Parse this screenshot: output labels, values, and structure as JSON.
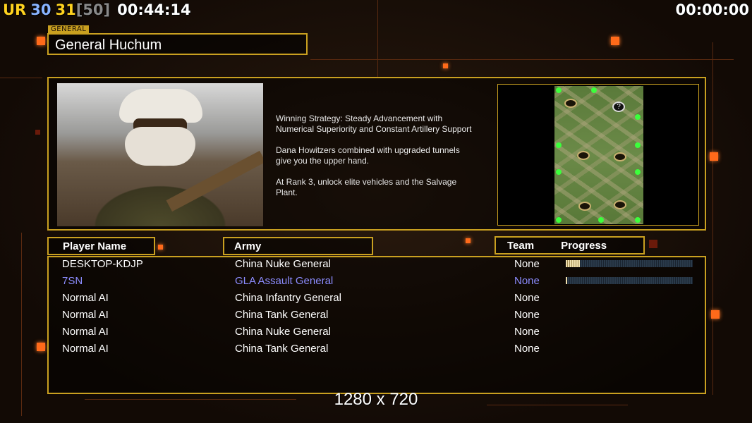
{
  "hud": {
    "ur": "UR",
    "n1": "30",
    "n2": "31",
    "bracket": "[50]",
    "clock_left": "00:44:14",
    "clock_right": "00:00:00"
  },
  "general": {
    "label": "GENERAL",
    "name": "General Huchum"
  },
  "strategy": {
    "p1": "Winning Strategy: Steady Advancement with\n Numerical Superiority and Constant Artillery Support",
    "p2": "Dana Howitzers combined with upgraded tunnels\n give you the upper hand.",
    "p3": "At Rank 3, unlock elite vehicles and the Salvage\n Plant."
  },
  "minimap": {
    "question": "?"
  },
  "headers": {
    "player": "Player Name",
    "army": "Army",
    "team": "Team",
    "progress": "Progress"
  },
  "players": [
    {
      "name": "DESKTOP-KDJP",
      "army": "China Nuke General",
      "team": "None",
      "progress": 0.11
    },
    {
      "name": "7SN",
      "army": "GLA Assault General",
      "team": "None",
      "progress": 0.01
    },
    {
      "name": "Normal AI",
      "army": "China Infantry General",
      "team": "None"
    },
    {
      "name": "Normal AI",
      "army": "China Tank General",
      "team": "None"
    },
    {
      "name": "Normal AI",
      "army": "China Nuke General",
      "team": "None"
    },
    {
      "name": "Normal AI",
      "army": "China Tank General",
      "team": "None"
    }
  ],
  "resolution": "1280 x 720",
  "colors": {
    "frame": "#c9a020",
    "highlight_player": "#8c8cff",
    "ur_yellow": "#ffd21f",
    "ur_green": "#3cd43c",
    "n1_blue": "#8ab4ff",
    "n2_yellow": "#ffd21f",
    "bracket_gray": "#8a8a8a"
  }
}
